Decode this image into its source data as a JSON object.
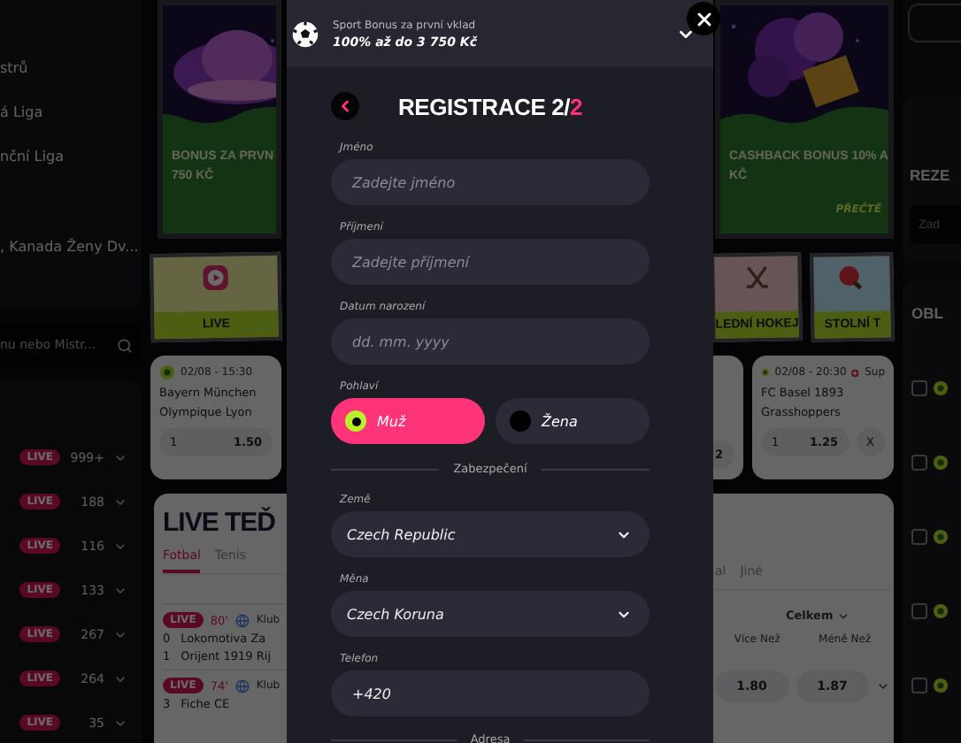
{
  "sidebar": {
    "leagues": [
      {
        "name": "strů"
      },
      {
        "name": "á Liga"
      },
      {
        "name": "nční Liga"
      },
      {
        "name": ", Kanada Ženy Dv..."
      }
    ],
    "search": {
      "placeholder": "nu nebo Mistr..."
    },
    "sports": [
      {
        "badge": "LIVE",
        "count": "999+"
      },
      {
        "badge": "LIVE",
        "count": "188"
      },
      {
        "badge": "LIVE",
        "count": "116"
      },
      {
        "badge": "LIVE",
        "count": "133"
      },
      {
        "badge": "LIVE",
        "count": "267"
      },
      {
        "badge": "LIVE",
        "count": "264"
      },
      {
        "badge": "LIVE",
        "count": "35"
      }
    ]
  },
  "banners": [
    {
      "title": "BONUS ZA PRVN",
      "subtitle": "750 KČ"
    },
    {
      "title": "CASHBACK BONUS 10% A",
      "subtitle": "KČ",
      "link": "PŘEČTĚ"
    }
  ],
  "tiles": [
    {
      "kind": "live",
      "label": "LIVE"
    },
    {
      "kind": "hockey",
      "label": "LEDNÍ HOKEJ"
    },
    {
      "kind": "table_tennis",
      "label": "STOLNÍ T"
    }
  ],
  "matches": [
    {
      "time": "02/08 - 15:30",
      "home": "Bayern München",
      "away": "Olympique Lyon",
      "odds": [
        {
          "label": "1",
          "value": "1.50"
        }
      ]
    },
    {
      "odds": [
        {
          "value": "2"
        }
      ]
    },
    {
      "time": "02/08 - 20:30",
      "league": "Sup",
      "home": "FC Basel 1893",
      "away": "Grasshoppers",
      "odds": [
        {
          "label": "1",
          "value": "1.25"
        },
        {
          "label": "X"
        }
      ]
    }
  ],
  "live_now": {
    "title": "LIVE TEĎ",
    "tabs": [
      {
        "label": "Fotbal",
        "selected": true
      },
      {
        "label": "Tenis",
        "selected": false
      },
      {
        "label": "al",
        "selected": false
      },
      {
        "label": "Jiné",
        "selected": false
      }
    ],
    "market": "Celkem",
    "columns": [
      "Více Než",
      "Méně Než"
    ],
    "events": [
      {
        "badge": "LIVE",
        "minute": "80'",
        "league": "Klub",
        "teams": [
          {
            "score": "0",
            "name": "Lokomotiva Za"
          },
          {
            "score": "1",
            "name": "Orijent 1919 Rij"
          }
        ],
        "odds": [
          "1.80",
          "1.87"
        ]
      },
      {
        "badge": "LIVE",
        "minute": "74'",
        "league": "Klub",
        "teams": [
          {
            "score": "3",
            "name": "Fiche CE"
          }
        ]
      }
    ]
  },
  "betslip": {
    "title": "REZE",
    "placeholder": "Zad",
    "section": "OBL",
    "rows": [
      {
        "checked": false
      },
      {
        "checked": false
      },
      {
        "checked": false
      },
      {
        "checked": false
      },
      {
        "checked": false
      }
    ]
  },
  "registration": {
    "bonus": {
      "caption": "Sport Bonus za první vklad",
      "amount": "100% až do 3 750 Kč"
    },
    "title": "REGISTRACE 2/",
    "title_accent": "2",
    "fields": [
      {
        "kind": "text",
        "label": "Jméno",
        "placeholder": "Zadejte jméno"
      },
      {
        "kind": "text",
        "label": "Příjmení",
        "placeholder": "Zadejte příjmení"
      },
      {
        "kind": "text",
        "label": "Datum narození",
        "placeholder": "dd. mm. yyyy"
      },
      {
        "kind": "gender",
        "label": "Pohlaví",
        "options": [
          {
            "label": "Muž",
            "selected": true
          },
          {
            "label": "Žena",
            "selected": false
          }
        ]
      },
      {
        "kind": "divider",
        "label": "Zabezpečení"
      },
      {
        "kind": "select",
        "label": "Země",
        "value": "Czech Republic"
      },
      {
        "kind": "select",
        "label": "Měna",
        "value": "Czech Koruna"
      },
      {
        "kind": "text",
        "label": "Telefon",
        "value": "+420"
      },
      {
        "kind": "divider",
        "label": "Adresa"
      }
    ]
  }
}
